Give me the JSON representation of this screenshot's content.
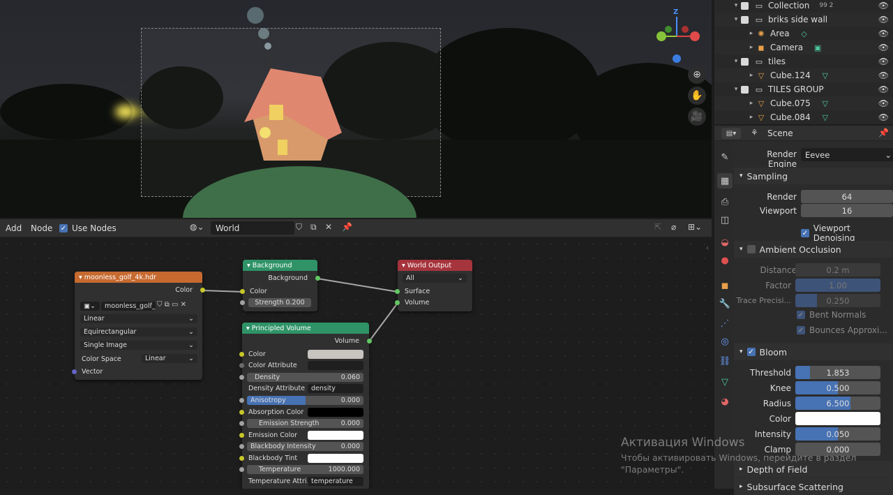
{
  "outliner": {
    "rows": [
      {
        "name": "Collection",
        "indent": 1,
        "type": "collection",
        "extra": "99 2"
      },
      {
        "name": "briks side wall",
        "indent": 1,
        "type": "collection"
      },
      {
        "name": "Area",
        "indent": 2,
        "type": "light"
      },
      {
        "name": "Camera",
        "indent": 2,
        "type": "camera"
      },
      {
        "name": "tiles",
        "indent": 1,
        "type": "collection"
      },
      {
        "name": "Cube.124",
        "indent": 2,
        "type": "mesh"
      },
      {
        "name": "TILES GROUP",
        "indent": 1,
        "type": "collection"
      },
      {
        "name": "Cube.075",
        "indent": 2,
        "type": "mesh"
      },
      {
        "name": "Cube.084",
        "indent": 2,
        "type": "mesh"
      }
    ]
  },
  "properties": {
    "context": "Scene",
    "render_engine_label": "Render Engine",
    "render_engine": "Eevee",
    "sampling": {
      "title": "Sampling",
      "render_label": "Render",
      "render": "64",
      "viewport_label": "Viewport",
      "viewport": "16",
      "denoise_label": "Viewport Denoising"
    },
    "ao": {
      "title": "Ambient Occlusion",
      "distance_label": "Distance",
      "distance": "0.2 m",
      "factor_label": "Factor",
      "factor": "1.00",
      "trace_label": "Trace Precisi...",
      "trace": "0.250",
      "bent_label": "Bent Normals",
      "bounces_label": "Bounces Approxi..."
    },
    "bloom": {
      "title": "Bloom",
      "threshold_label": "Threshold",
      "threshold": "1.853",
      "threshold_frac": 0.17,
      "knee_label": "Knee",
      "knee": "0.500",
      "knee_frac": 0.5,
      "radius_label": "Radius",
      "radius": "6.500",
      "radius_frac": 0.65,
      "color_label": "Color",
      "intensity_label": "Intensity",
      "intensity": "0.050",
      "intensity_frac": 0.5,
      "clamp_label": "Clamp",
      "clamp": "0.000"
    },
    "dof_title": "Depth of Field",
    "sss_title": "Subsurface Scattering",
    "colors": {
      "bloom_color": "#ffffff",
      "accent": "#4772b3"
    }
  },
  "node_editor": {
    "menu_add": "Add",
    "menu_node": "Node",
    "use_nodes_label": "Use Nodes",
    "world_name": "World"
  },
  "nodes": {
    "env": {
      "title": "moonless_golf_4k.hdr",
      "out_color": "Color",
      "image_name": "moonless_golf_4...",
      "interp": "Linear",
      "projection": "Equirectangular",
      "source": "Single Image",
      "colorspace_label": "Color Space",
      "colorspace": "Linear",
      "in_vector": "Vector"
    },
    "background": {
      "title": "Background",
      "out": "Background",
      "in_color": "Color",
      "strength_label": "Strength",
      "strength": "0.200"
    },
    "world_output": {
      "title": "World Output",
      "target": "All",
      "in_surface": "Surface",
      "in_volume": "Volume"
    },
    "volume": {
      "title": "Principled Volume",
      "out": "Volume",
      "color": "Color",
      "color_attr": "Color Attribute",
      "density_label": "Density",
      "density": "0.060",
      "density_attr": "Density Attribute",
      "density_attr_val": "density",
      "aniso_label": "Anisotropy",
      "aniso": "0.000",
      "absorption": "Absorption Color",
      "emission_strength_label": "Emission Strength",
      "emission_strength": "0.000",
      "emission_color": "Emission Color",
      "blackbody_label": "Blackbody Intensity",
      "blackbody": "0.000",
      "blackbody_tint": "Blackbody Tint",
      "temperature_label": "Temperature",
      "temperature": "1000.000",
      "temp_attr": "Temperature Attri...",
      "temp_attr_val": "temperature",
      "colors": {
        "color": "#c8c4c0",
        "absorption": "#000000",
        "emission": "#ffffff",
        "tint": "#ffffff"
      }
    }
  },
  "watermark": {
    "title": "Активация Windows",
    "line1": "Чтобы активировать Windows, перейдите в раздел",
    "line2": "\"Параметры\"."
  }
}
